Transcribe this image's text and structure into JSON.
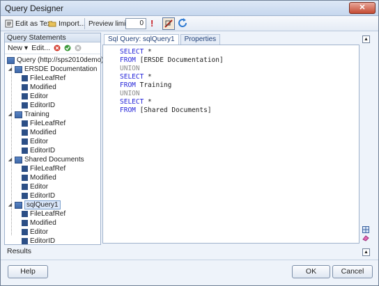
{
  "window": {
    "title": "Query Designer",
    "close_glyph": "✕"
  },
  "toolbar": {
    "edit_as_text": "Edit as Text",
    "import": "Import...",
    "preview_limit_label": "Preview limit:",
    "preview_limit_value": "0",
    "warning_glyph": "!"
  },
  "left_panel": {
    "title": "Query Statements",
    "new_label": "New",
    "edit_label": "Edit...",
    "root_label": "Query (http://sps2010demo)",
    "groups": [
      {
        "name": "ERSDE Documentation",
        "fields": [
          "FileLeafRef",
          "Modified",
          "Editor",
          "EditorID"
        ]
      },
      {
        "name": "Training",
        "fields": [
          "FileLeafRef",
          "Modified",
          "Editor",
          "EditorID"
        ]
      },
      {
        "name": "Shared Documents",
        "fields": [
          "FileLeafRef",
          "Modified",
          "Editor",
          "EditorID"
        ]
      },
      {
        "name": "sqlQuery1",
        "fields": [
          "FileLeafRef",
          "Modified",
          "Editor",
          "EditorID"
        ]
      }
    ]
  },
  "tabs": {
    "sql_query": "Sql Query: sqlQuery1",
    "properties": "Properties"
  },
  "sql": {
    "lines": [
      {
        "kw": "SELECT",
        "rest": " *"
      },
      {
        "kw": "FROM",
        "rest": " [ERSDE Documentation]"
      },
      {
        "kw": "UNION",
        "rest": ""
      },
      {
        "kw": "SELECT",
        "rest": " *"
      },
      {
        "kw": "FROM",
        "rest": " Training"
      },
      {
        "kw": "UNION",
        "rest": ""
      },
      {
        "kw": "SELECT",
        "rest": " *"
      },
      {
        "kw": "FROM",
        "rest": " [Shared Documents]"
      }
    ]
  },
  "results": {
    "label": "Results"
  },
  "buttons": {
    "help": "Help",
    "ok": "OK",
    "cancel": "Cancel"
  },
  "colors": {
    "keyword": "#2626d9",
    "union": "#8a8a8a",
    "accent": "#1f3f78"
  }
}
